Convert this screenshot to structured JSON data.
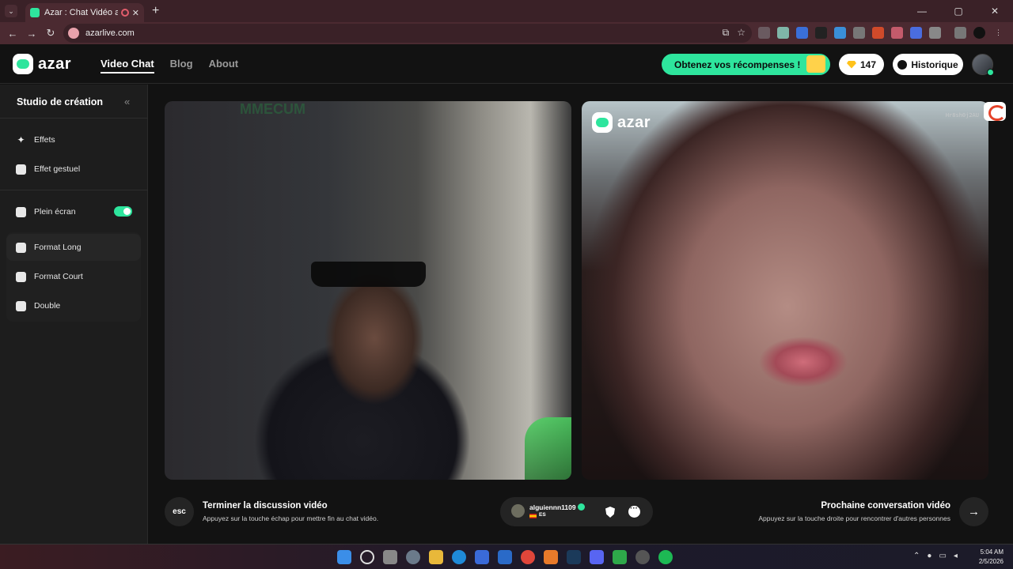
{
  "browser": {
    "tab_title": "Azar : Chat Vidéo avec de n",
    "tab_close": "✕",
    "new_tab": "+",
    "url": "azarlive.com",
    "window_controls": [
      "—",
      "▢",
      "✕"
    ],
    "nav": {
      "back": "←",
      "forward": "→",
      "reload": "↻"
    }
  },
  "header": {
    "logo_text": "azar",
    "nav": [
      {
        "label": "Video Chat",
        "active": true
      },
      {
        "label": "Blog"
      },
      {
        "label": "About"
      }
    ],
    "rewards_label": "Obtenez vos récompenses !",
    "gems_count": "147",
    "history_label": "Historique"
  },
  "sidebar": {
    "title": "Studio de création",
    "collapse_icon": "«",
    "items": [
      {
        "label": "Effets",
        "icon": "magic-wand-icon"
      },
      {
        "label": "Effet gestuel",
        "icon": "gesture-face-icon"
      },
      {
        "label": "Plein écran",
        "icon": "fullscreen-icon",
        "toggle_on": true
      },
      {
        "label": "Format Long",
        "icon": "layout-long-icon",
        "active": true
      },
      {
        "label": "Format Court",
        "icon": "layout-short-icon"
      },
      {
        "label": "Double",
        "icon": "layout-double-icon"
      }
    ]
  },
  "video": {
    "right_logo_text": "azar",
    "right_code": "Hr8sh0j2AU",
    "left_neon_text": "MMECUM"
  },
  "controls": {
    "esc_label": "esc",
    "end_title": "Terminer la discussion vidéo",
    "end_desc": "Appuyez sur la touche échap pour mettre fin au chat vidéo.",
    "peer_name": "alguiennn1109",
    "peer_country": "ES",
    "next_title": "Prochaine conversation vidéo",
    "next_desc": "Appuyez sur la touche droite pour rencontrer d'autres personnes",
    "next_icon": "→"
  },
  "taskbar": {
    "time": "5:04 AM",
    "date": "2/5/2026"
  },
  "colors": {
    "accent": "#2ee59d",
    "background": "#121212",
    "sidebar": "#1d1d1d"
  }
}
